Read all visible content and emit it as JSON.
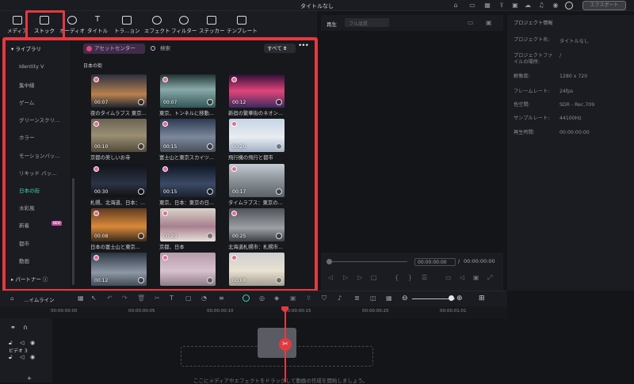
{
  "window": {
    "title": "タイトルなし",
    "export_label": "エクスポート"
  },
  "toolbar": {
    "items": [
      {
        "label": "メディア",
        "icon": "media-icon"
      },
      {
        "label": "ストック",
        "icon": "stock-icon"
      },
      {
        "label": "オーディオ",
        "icon": "music-icon"
      },
      {
        "label": "タイトル",
        "icon": "title-icon"
      },
      {
        "label": "トラ…ョン",
        "icon": "transition-icon"
      },
      {
        "label": "エフェクト",
        "icon": "effect-icon"
      },
      {
        "label": "フィルター",
        "icon": "filter-icon"
      },
      {
        "label": "ステッカー",
        "icon": "sticker-icon"
      },
      {
        "label": "テンプレート",
        "icon": "template-icon"
      }
    ]
  },
  "sidebar": {
    "library_label": "ライブラリ",
    "items": [
      "Identity V",
      "集中線",
      "ゲーム",
      "グリーンスクリ...",
      "ホラー",
      "モーションバッ...",
      "リキッド バッ...",
      "日本の街",
      "水彩風",
      "新着",
      "都市",
      "動画"
    ],
    "active": "日本の街",
    "new_badge": "NEW",
    "partner_label": "パートナー"
  },
  "content": {
    "asset_center_label": "アセットセンター",
    "search_placeholder": "検索",
    "filter_label": "すべて",
    "section_title": "日本の街",
    "cards": [
      {
        "caption": "夜のタイムラプス 東京...",
        "duration": "00:07"
      },
      {
        "caption": "東京、トンネルに移動...",
        "duration": "00:07"
      },
      {
        "caption": "新宿の繁華街のネオン...",
        "duration": "00:12"
      },
      {
        "caption": "京都の美しいお寺",
        "duration": "00:10"
      },
      {
        "caption": "富士山と東京スカイツ...",
        "duration": "00:15"
      },
      {
        "caption": "飛行機の飛行と都市",
        "duration": "00:20"
      },
      {
        "caption": "札幌、北海道、日本：...",
        "duration": "00:30"
      },
      {
        "caption": "東京、日本：東京の日...",
        "duration": "00:15"
      },
      {
        "caption": "タイムラプス：東京の...",
        "duration": "00:17"
      },
      {
        "caption": "日本の富士山と東京...",
        "duration": "00:08"
      },
      {
        "caption": "京都、日本",
        "duration": "00:23"
      },
      {
        "caption": "北海道札幌市：札幌市...",
        "duration": "00:25"
      },
      {
        "caption": "",
        "duration": "00:12"
      },
      {
        "caption": "",
        "duration": ""
      },
      {
        "caption": "",
        "duration": "00:08"
      }
    ]
  },
  "preview": {
    "tab_label": "再生",
    "quality_label": "フル品質",
    "current_time": "00:00:00:00",
    "separator": "/",
    "total_time": "00:00:00:00"
  },
  "info": {
    "header": "プロジェクト情報",
    "rows": [
      {
        "key": "プロジェクト名:",
        "value": "タイトルなし"
      },
      {
        "key": "プロジェクトファイルの場所:",
        "value": "/"
      },
      {
        "key": "解像度:",
        "value": "1280 x 720"
      },
      {
        "key": "フレームレート:",
        "value": "24fps"
      },
      {
        "key": "色空間:",
        "value": "SDR - Rec.709"
      },
      {
        "key": "サンプルレート:",
        "value": "44100Hz"
      },
      {
        "key": "再生時間:",
        "value": "00:00:00:00"
      }
    ]
  },
  "timeline": {
    "label": "…イムライン",
    "ticks": [
      "00:00:00:00",
      "00:00:00:05",
      "00:00:00:10",
      "00:00:00:15",
      "00:00:00:20",
      "00:00:01:01"
    ],
    "track_label": "ビデオ 3",
    "drop_hint": "ここにメディアやエフェクトをドラッグして動画の作成を開始しましょう。"
  },
  "colors": {
    "highlight": "#e5383f",
    "accent": "#3ed2b7"
  }
}
